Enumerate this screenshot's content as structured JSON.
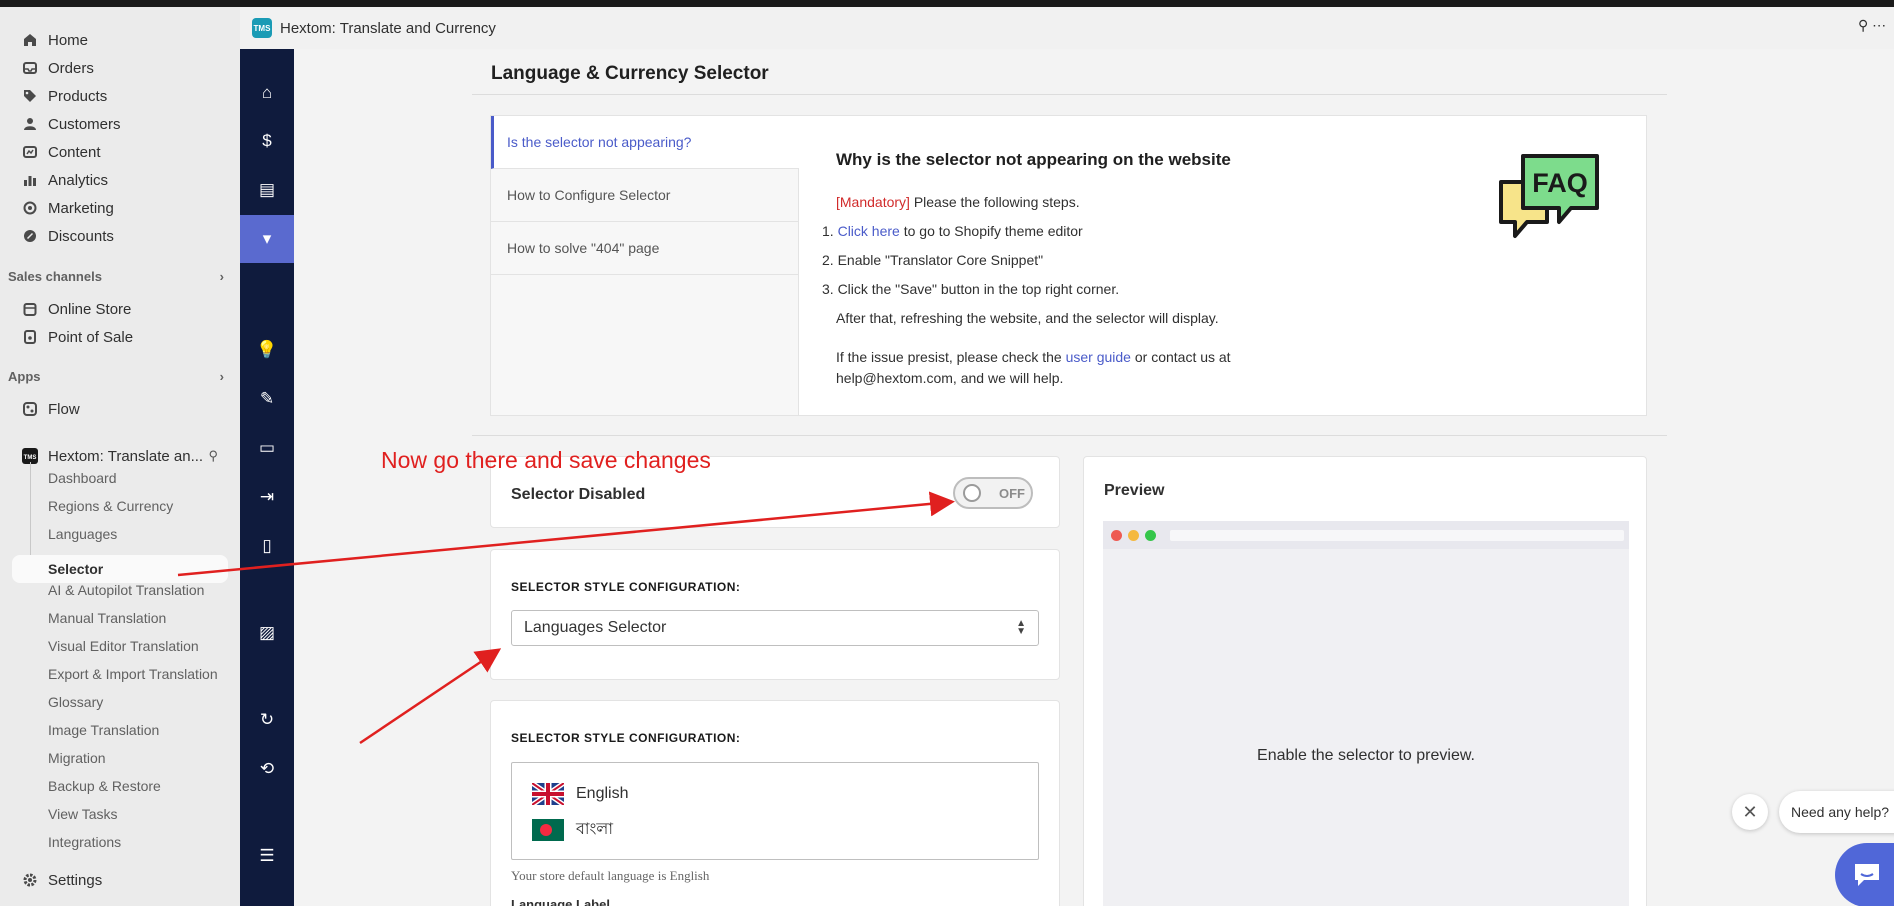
{
  "admin_nav": {
    "main": [
      {
        "label": "Home",
        "icon": "home-icon"
      },
      {
        "label": "Orders",
        "icon": "inbox-icon"
      },
      {
        "label": "Products",
        "icon": "tag-icon"
      },
      {
        "label": "Customers",
        "icon": "person-icon"
      },
      {
        "label": "Content",
        "icon": "content-icon"
      },
      {
        "label": "Analytics",
        "icon": "bar-chart-icon"
      },
      {
        "label": "Marketing",
        "icon": "target-icon"
      },
      {
        "label": "Discounts",
        "icon": "discount-icon"
      }
    ],
    "sales_channels_heading": "Sales channels",
    "sales_channels": [
      {
        "label": "Online Store",
        "icon": "store-icon"
      },
      {
        "label": "Point of Sale",
        "icon": "pos-icon"
      }
    ],
    "apps_heading": "Apps",
    "apps": [
      {
        "label": "Flow",
        "icon": "flow-icon"
      },
      {
        "label": "Hextom: Translate an...",
        "icon": "app-logo-icon"
      }
    ],
    "app_subitems": [
      "Dashboard",
      "Regions & Currency",
      "Languages",
      "Selector",
      "AI & Autopilot Translation",
      "Manual Translation",
      "Visual Editor Translation",
      "Export & Import Translation",
      "Glossary",
      "Image Translation",
      "Migration",
      "Backup & Restore",
      "View Tasks",
      "Integrations"
    ],
    "active_subitem": "Selector",
    "settings": "Settings"
  },
  "app_header": {
    "logo_text": "TMS",
    "title": "Hextom: Translate and Currency"
  },
  "page": {
    "title": "Language & Currency Selector"
  },
  "faq": {
    "tabs": [
      "Is the selector not appearing?",
      "How to Configure Selector",
      "How to solve \"404\" page"
    ],
    "active_tab": 0,
    "heading": "Why is the selector not appearing on the website",
    "mandatory_tag": "[Mandatory]",
    "intro": " Please the following steps.",
    "step1_num": "1.",
    "step1_link": "Click here",
    "step1_rest": " to go to Shopify theme editor",
    "step2": "2. Enable \"Translator Core Snippet\"",
    "step3": "3. Click the \"Save\" button in the top right corner.",
    "after": "After that, refreshing the website, and the selector will display.",
    "issue_pre": "If the issue presist, please check the ",
    "issue_link": "user guide",
    "issue_post": " or contact us at",
    "issue_line2": "help@hextom.com, and we will help.",
    "badge_text": "FAQ"
  },
  "selector_toggle": {
    "label": "Selector Disabled",
    "state": "OFF"
  },
  "style_config_1": {
    "heading": "SELECTOR STYLE CONFIGURATION:",
    "selected": "Languages Selector"
  },
  "style_config_2": {
    "heading": "SELECTOR STYLE CONFIGURATION:",
    "languages": [
      {
        "name": "English",
        "flag": "uk-flag-icon"
      },
      {
        "name": "বাংলা",
        "flag": "bangladesh-flag-icon"
      }
    ],
    "default_note": "Your store default language is English",
    "next_label": "Language Label"
  },
  "preview": {
    "title": "Preview",
    "message": "Enable the selector to preview.",
    "dot_colors": [
      "#ee5a52",
      "#f5b93f",
      "#35c64a"
    ]
  },
  "annotation": {
    "text": "Now go there and save changes",
    "color": "#e0201f"
  },
  "help_widget": {
    "text": "Need any help?",
    "accent": "#5067d8"
  },
  "colors": {
    "rail": "#0f1b3d",
    "rail_active": "#5a6acf",
    "link": "#4a5bc9"
  }
}
